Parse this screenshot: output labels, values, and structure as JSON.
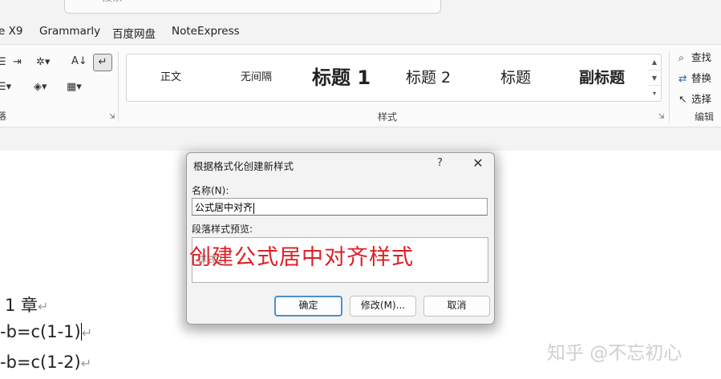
{
  "search": {
    "placeholder": "搜索"
  },
  "tabs": [
    "e X9",
    "Grammarly",
    "百度网盘",
    "NoteExpress"
  ],
  "ribbon": {
    "paragraph_group_label": "落",
    "styles_group_label": "样式",
    "editing_group_label": "编辑",
    "styles": [
      "正文",
      "无间隔",
      "标题 1",
      "标题 2",
      "标题",
      "副标题"
    ],
    "editing": {
      "find": "查找",
      "replace": "替换",
      "select": "选择"
    }
  },
  "document": {
    "lines": [
      "1 章",
      "-b=c(1-1)",
      "-b=c(1-2)"
    ],
    "paragraph_mark": "↵"
  },
  "dialog": {
    "title": "根据格式化创建新样式",
    "help": "?",
    "close": "✕",
    "name_label": "名称(N):",
    "name_value": "公式居中对齐",
    "preview_label": "段落样式预览:",
    "preview_sample": "样式2",
    "annotation": "创建公式居中对齐样式",
    "buttons": {
      "ok": "确定",
      "modify": "修改(M)...",
      "cancel": "取消"
    }
  },
  "watermark": "知乎 @不忘初心",
  "colors": {
    "annotation": "#dd1f26",
    "default_button_border": "#4a8fd0"
  }
}
